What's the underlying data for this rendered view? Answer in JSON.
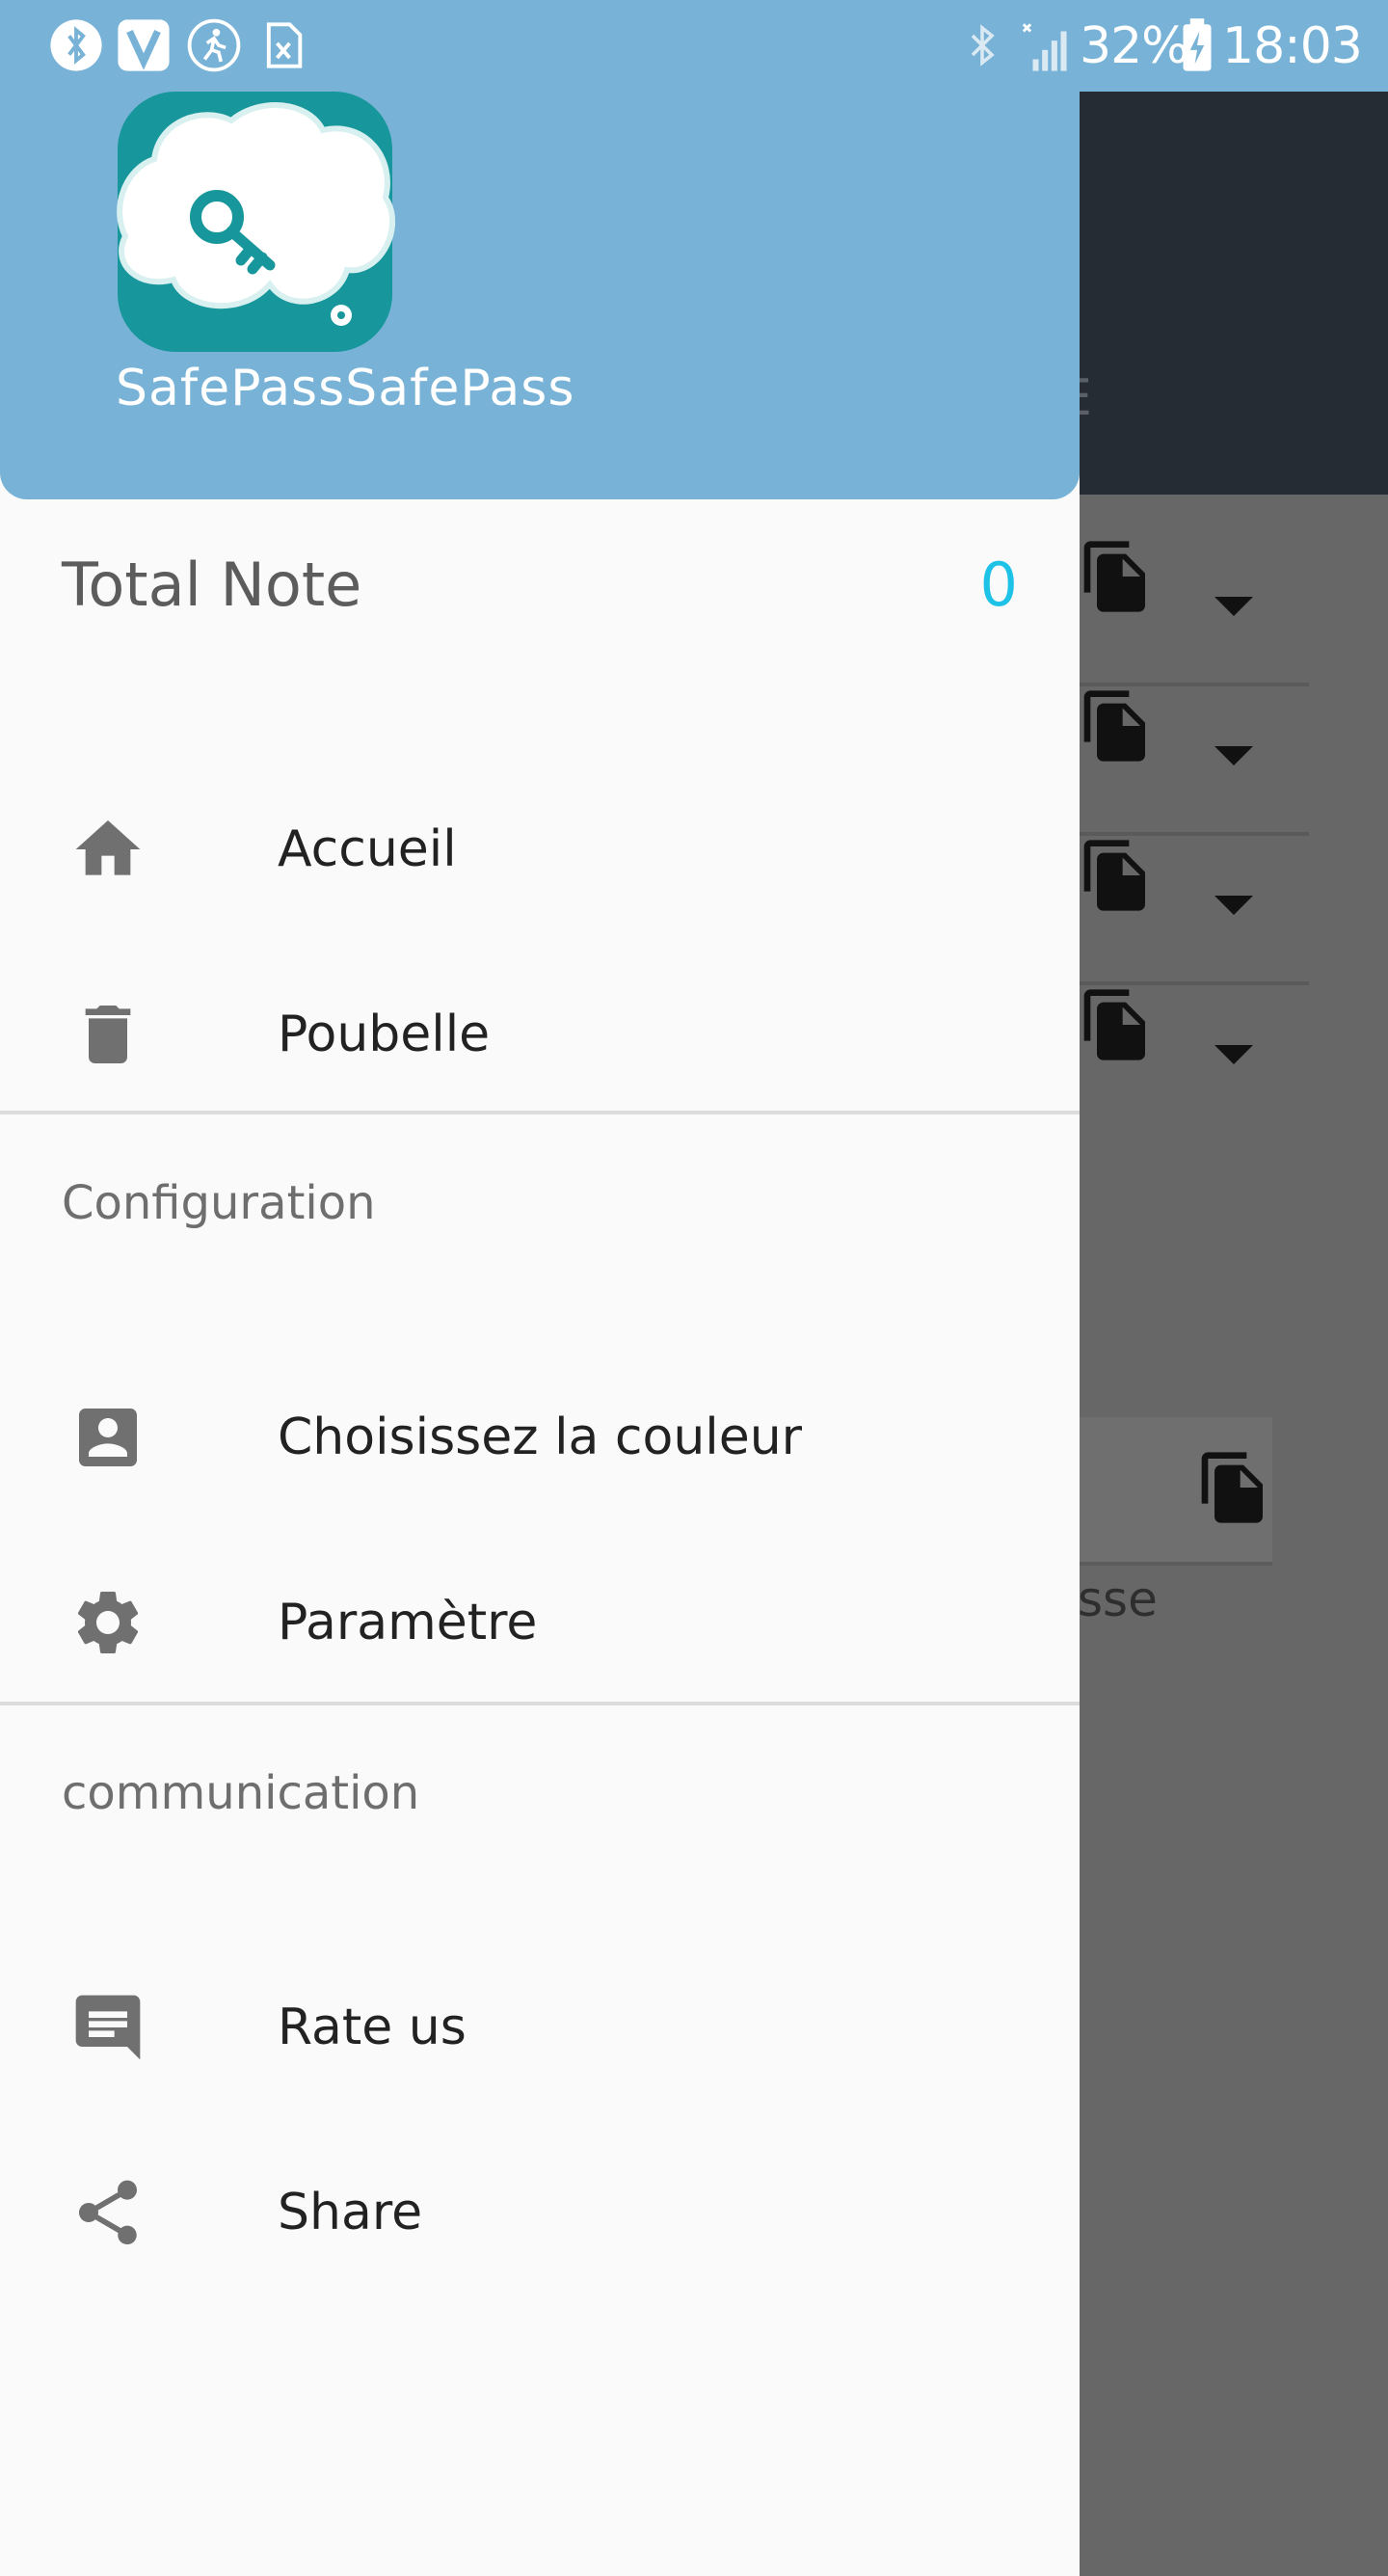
{
  "status_bar": {
    "battery": "32%",
    "time": "18:03"
  },
  "background": {
    "toolbar_fragment": "E",
    "card_text_fragment": "sse"
  },
  "drawer": {
    "app_name": "SafePassSafePass",
    "total_label": "Total Note",
    "total_count": "0",
    "main_items": [
      {
        "label": "Accueil",
        "icon": "home-icon"
      },
      {
        "label": "Poubelle",
        "icon": "trash-icon"
      }
    ],
    "config_header": "Configuration",
    "config_items": [
      {
        "label": "Choisissez la couleur",
        "icon": "contact-icon"
      },
      {
        "label": "Paramètre",
        "icon": "gear-icon"
      }
    ],
    "communication_header": "communication",
    "communication_items": [
      {
        "label": "Rate us",
        "icon": "feedback-icon"
      },
      {
        "label": "Share",
        "icon": "share-icon"
      }
    ]
  },
  "colors": {
    "header": "#78b3d7",
    "accent_count": "#1ec2e6",
    "logo_teal": "#17979b",
    "icon_gray": "#707070"
  }
}
